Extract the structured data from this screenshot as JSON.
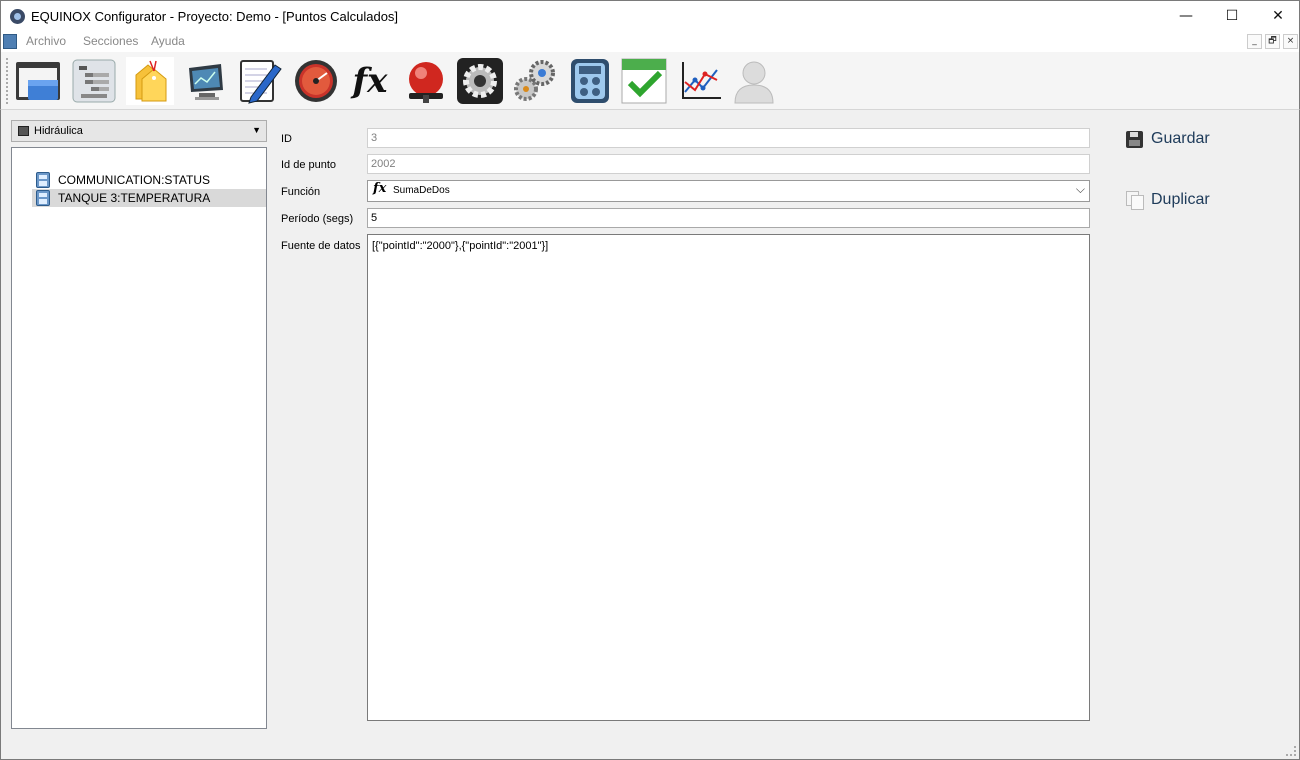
{
  "window": {
    "title": "EQUINOX Configurator - Proyecto: Demo - [Puntos Calculados]",
    "minimize": "—",
    "maximize": "☐",
    "close": "✕"
  },
  "menu": {
    "items": [
      "Archivo",
      "Secciones",
      "Ayuda"
    ],
    "mdi_controls": [
      "_",
      "🗗",
      "×"
    ]
  },
  "toolbar": {
    "icons": [
      "window-icon",
      "tree-list-icon",
      "tags-icon",
      "monitor-icon",
      "notepad-icon",
      "gauge-icon",
      "function-icon",
      "alarm-bell-icon",
      "settings-gear-icon",
      "gears-icon",
      "calculator-icon",
      "calendar-check-icon",
      "line-chart-icon",
      "user-icon"
    ],
    "fx_glyph": "fx"
  },
  "sidebar": {
    "selector_value": "Hidráulica",
    "tree_items": [
      {
        "label": "COMMUNICATION:STATUS",
        "selected": false
      },
      {
        "label": "TANQUE 3:TEMPERATURA",
        "selected": true
      }
    ]
  },
  "form": {
    "id_label": "ID",
    "id_value": "3",
    "point_id_label": "Id de punto",
    "point_id_value": "2002",
    "function_label": "Función",
    "function_value": "SumaDeDos",
    "function_icon": "fx",
    "period_label": "Período (segs)",
    "period_value": "5",
    "datasource_label": "Fuente de datos",
    "datasource_value": "[{\"pointId\":\"2000\"},{\"pointId\":\"2001\"}]"
  },
  "actions": {
    "save_label": "Guardar",
    "duplicate_label": "Duplicar"
  }
}
